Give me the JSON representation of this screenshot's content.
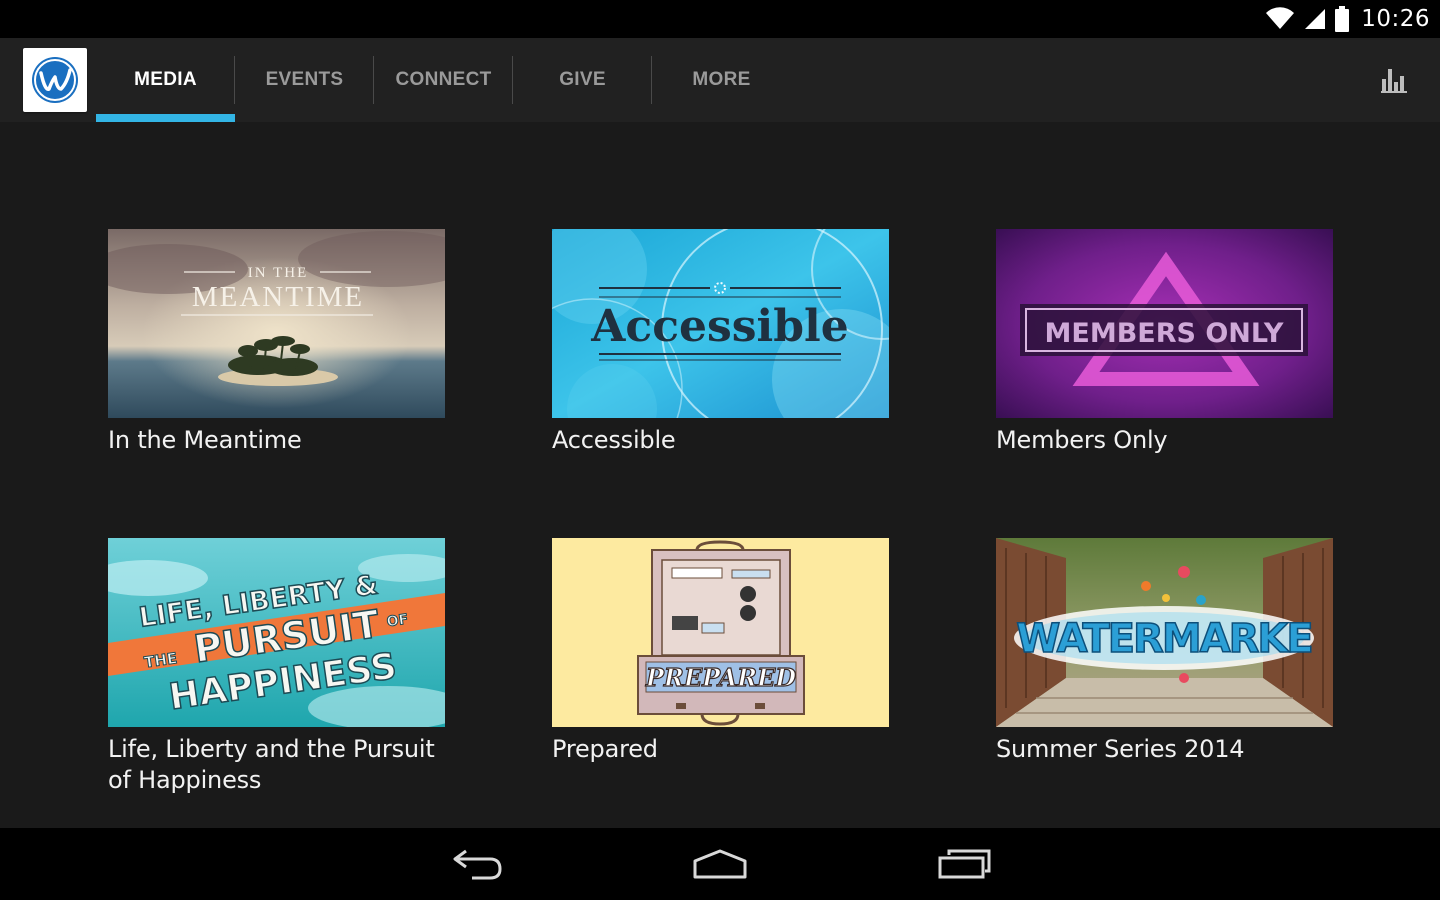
{
  "status_bar": {
    "time": "10:26",
    "icons": [
      "wifi-icon",
      "cell-signal-icon",
      "battery-icon"
    ]
  },
  "action_bar": {
    "logo_icon": "app-logo-w-icon",
    "tabs": [
      {
        "label": "MEDIA",
        "active": true
      },
      {
        "label": "EVENTS",
        "active": false
      },
      {
        "label": "CONNECT",
        "active": false
      },
      {
        "label": "GIVE",
        "active": false
      },
      {
        "label": "MORE",
        "active": false
      }
    ],
    "action_icon": "bar-chart-icon",
    "accent_color": "#33b5e5"
  },
  "media": {
    "items": [
      {
        "title": "In the Meantime",
        "artwork_text": [
          "IN THE",
          "MEANTIME"
        ]
      },
      {
        "title": "Accessible",
        "artwork_text": [
          "Accessible"
        ]
      },
      {
        "title": "Members Only",
        "artwork_text": [
          "MEMBERS ONLY"
        ]
      },
      {
        "title": "Life, Liberty and the Pursuit of Happiness",
        "artwork_text": [
          "LIFE, LIBERTY &",
          "THE",
          "PURSUIT",
          "OF",
          "HAPPINESS"
        ]
      },
      {
        "title": "Prepared",
        "artwork_text": [
          "PREPARED"
        ]
      },
      {
        "title": "Summer Series 2014",
        "artwork_text": [
          "WATERMARKE"
        ]
      }
    ]
  },
  "nav_bar": {
    "icons": [
      "back-icon",
      "home-icon",
      "recent-apps-icon"
    ]
  }
}
